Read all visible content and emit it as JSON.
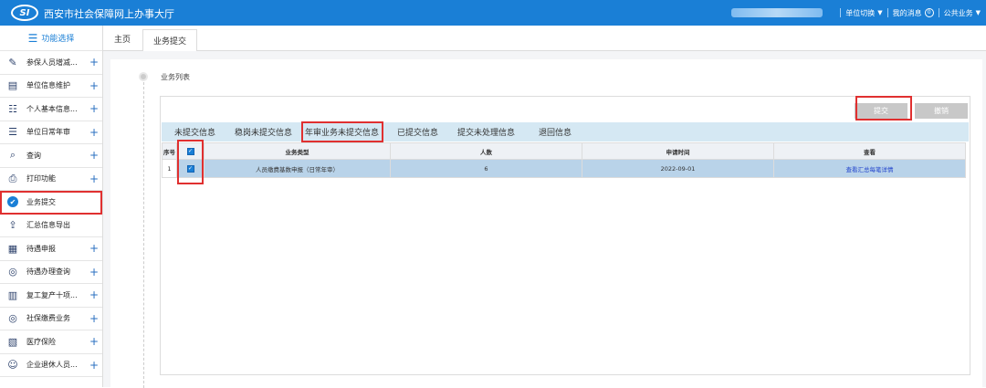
{
  "header": {
    "logo_text": "SI",
    "title": "西安市社会保障网上办事大厅",
    "unit_switch": "单位切换",
    "my_messages": "我的消息",
    "message_count": "0",
    "public_business": "公共业务",
    "colors": {
      "header_bg": "#1a7fd6",
      "highlight": "#e03030"
    }
  },
  "sidebar": {
    "heading": "功能选择",
    "items": [
      {
        "label": "参保人员增减...",
        "icon": "person-edit-icon",
        "expandable": true
      },
      {
        "label": "单位信息维护",
        "icon": "document-icon",
        "expandable": true
      },
      {
        "label": "个人基本信息...",
        "icon": "person-card-icon",
        "expandable": true
      },
      {
        "label": "单位日常年审",
        "icon": "list-icon",
        "expandable": true
      },
      {
        "label": "查询",
        "icon": "search-icon",
        "expandable": true
      },
      {
        "label": "打印功能",
        "icon": "printer-icon",
        "expandable": true
      },
      {
        "label": "业务提交",
        "icon": "check-circle-icon",
        "expandable": false,
        "active": true
      },
      {
        "label": "汇总信息导出",
        "icon": "export-icon",
        "expandable": false
      },
      {
        "label": "待遇申报",
        "icon": "report-icon",
        "expandable": true
      },
      {
        "label": "待遇办理查询",
        "icon": "search-circle-icon",
        "expandable": true
      },
      {
        "label": "复工复产十项...",
        "icon": "document-list-icon",
        "expandable": true
      },
      {
        "label": "社保缴费业务",
        "icon": "search-circle-icon",
        "expandable": true
      },
      {
        "label": "医疗保险",
        "icon": "medical-doc-icon",
        "expandable": true
      },
      {
        "label": "企业退休人员...",
        "icon": "person-icon",
        "expandable": true
      }
    ]
  },
  "tabs": [
    {
      "label": "主页"
    },
    {
      "label": "业务提交",
      "active": true
    }
  ],
  "main": {
    "section_title": "业务列表",
    "buttons": {
      "submit": "提交",
      "revoke": "撤销"
    },
    "subtabs": [
      "未提交信息",
      "稳岗未提交信息",
      "年审业务未提交信息",
      "已提交信息",
      "提交未处理信息",
      "退回信息"
    ],
    "active_subtab": "年审业务未提交信息",
    "table": {
      "columns": [
        "序号",
        "",
        "业务类型",
        "人数",
        "申请时间",
        "查看"
      ],
      "rows": [
        {
          "seq": "1",
          "checked": true,
          "type": "人员缴费基数申报（日常年审）",
          "count": "6",
          "date": "2022-09-01",
          "view": "查看汇总每笔详情"
        }
      ]
    }
  }
}
